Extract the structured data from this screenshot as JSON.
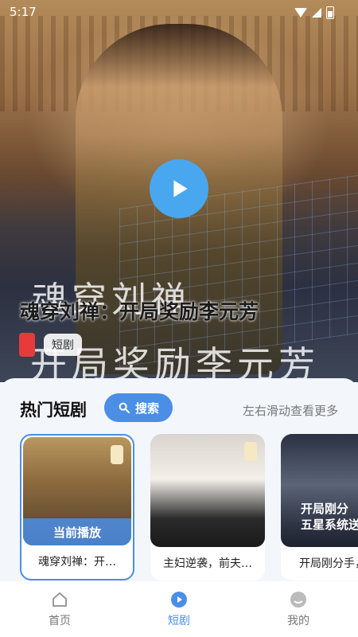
{
  "status_bar": {
    "time": "5:17"
  },
  "hero": {
    "title": "魂穿刘禅：开局奖励李元芳",
    "calligraphy_line1": "魂穿刘禅",
    "calligraphy_line2": "开局奖励李元芳",
    "tag": "短剧",
    "accent_color": "#49a7ef"
  },
  "section": {
    "title": "热门短剧",
    "search_label": "搜索",
    "hint": "左右滑动查看更多"
  },
  "cards": [
    {
      "name": "魂穿刘禅：开…",
      "badge": "当前播放",
      "active": true
    },
    {
      "name": "主妇逆袭，前夫…",
      "active": false
    },
    {
      "name": "开局刚分手，…",
      "overlay": "开局刚分\n五星系统送",
      "active": false
    }
  ],
  "bottom_nav": [
    {
      "label": "首页",
      "icon": "home-icon",
      "active": false
    },
    {
      "label": "短剧",
      "icon": "play-circle-icon",
      "active": true
    },
    {
      "label": "我的",
      "icon": "profile-icon",
      "active": false
    }
  ],
  "colors": {
    "accent": "#4a8ee6",
    "panel_bg": "#f3f6fb"
  }
}
